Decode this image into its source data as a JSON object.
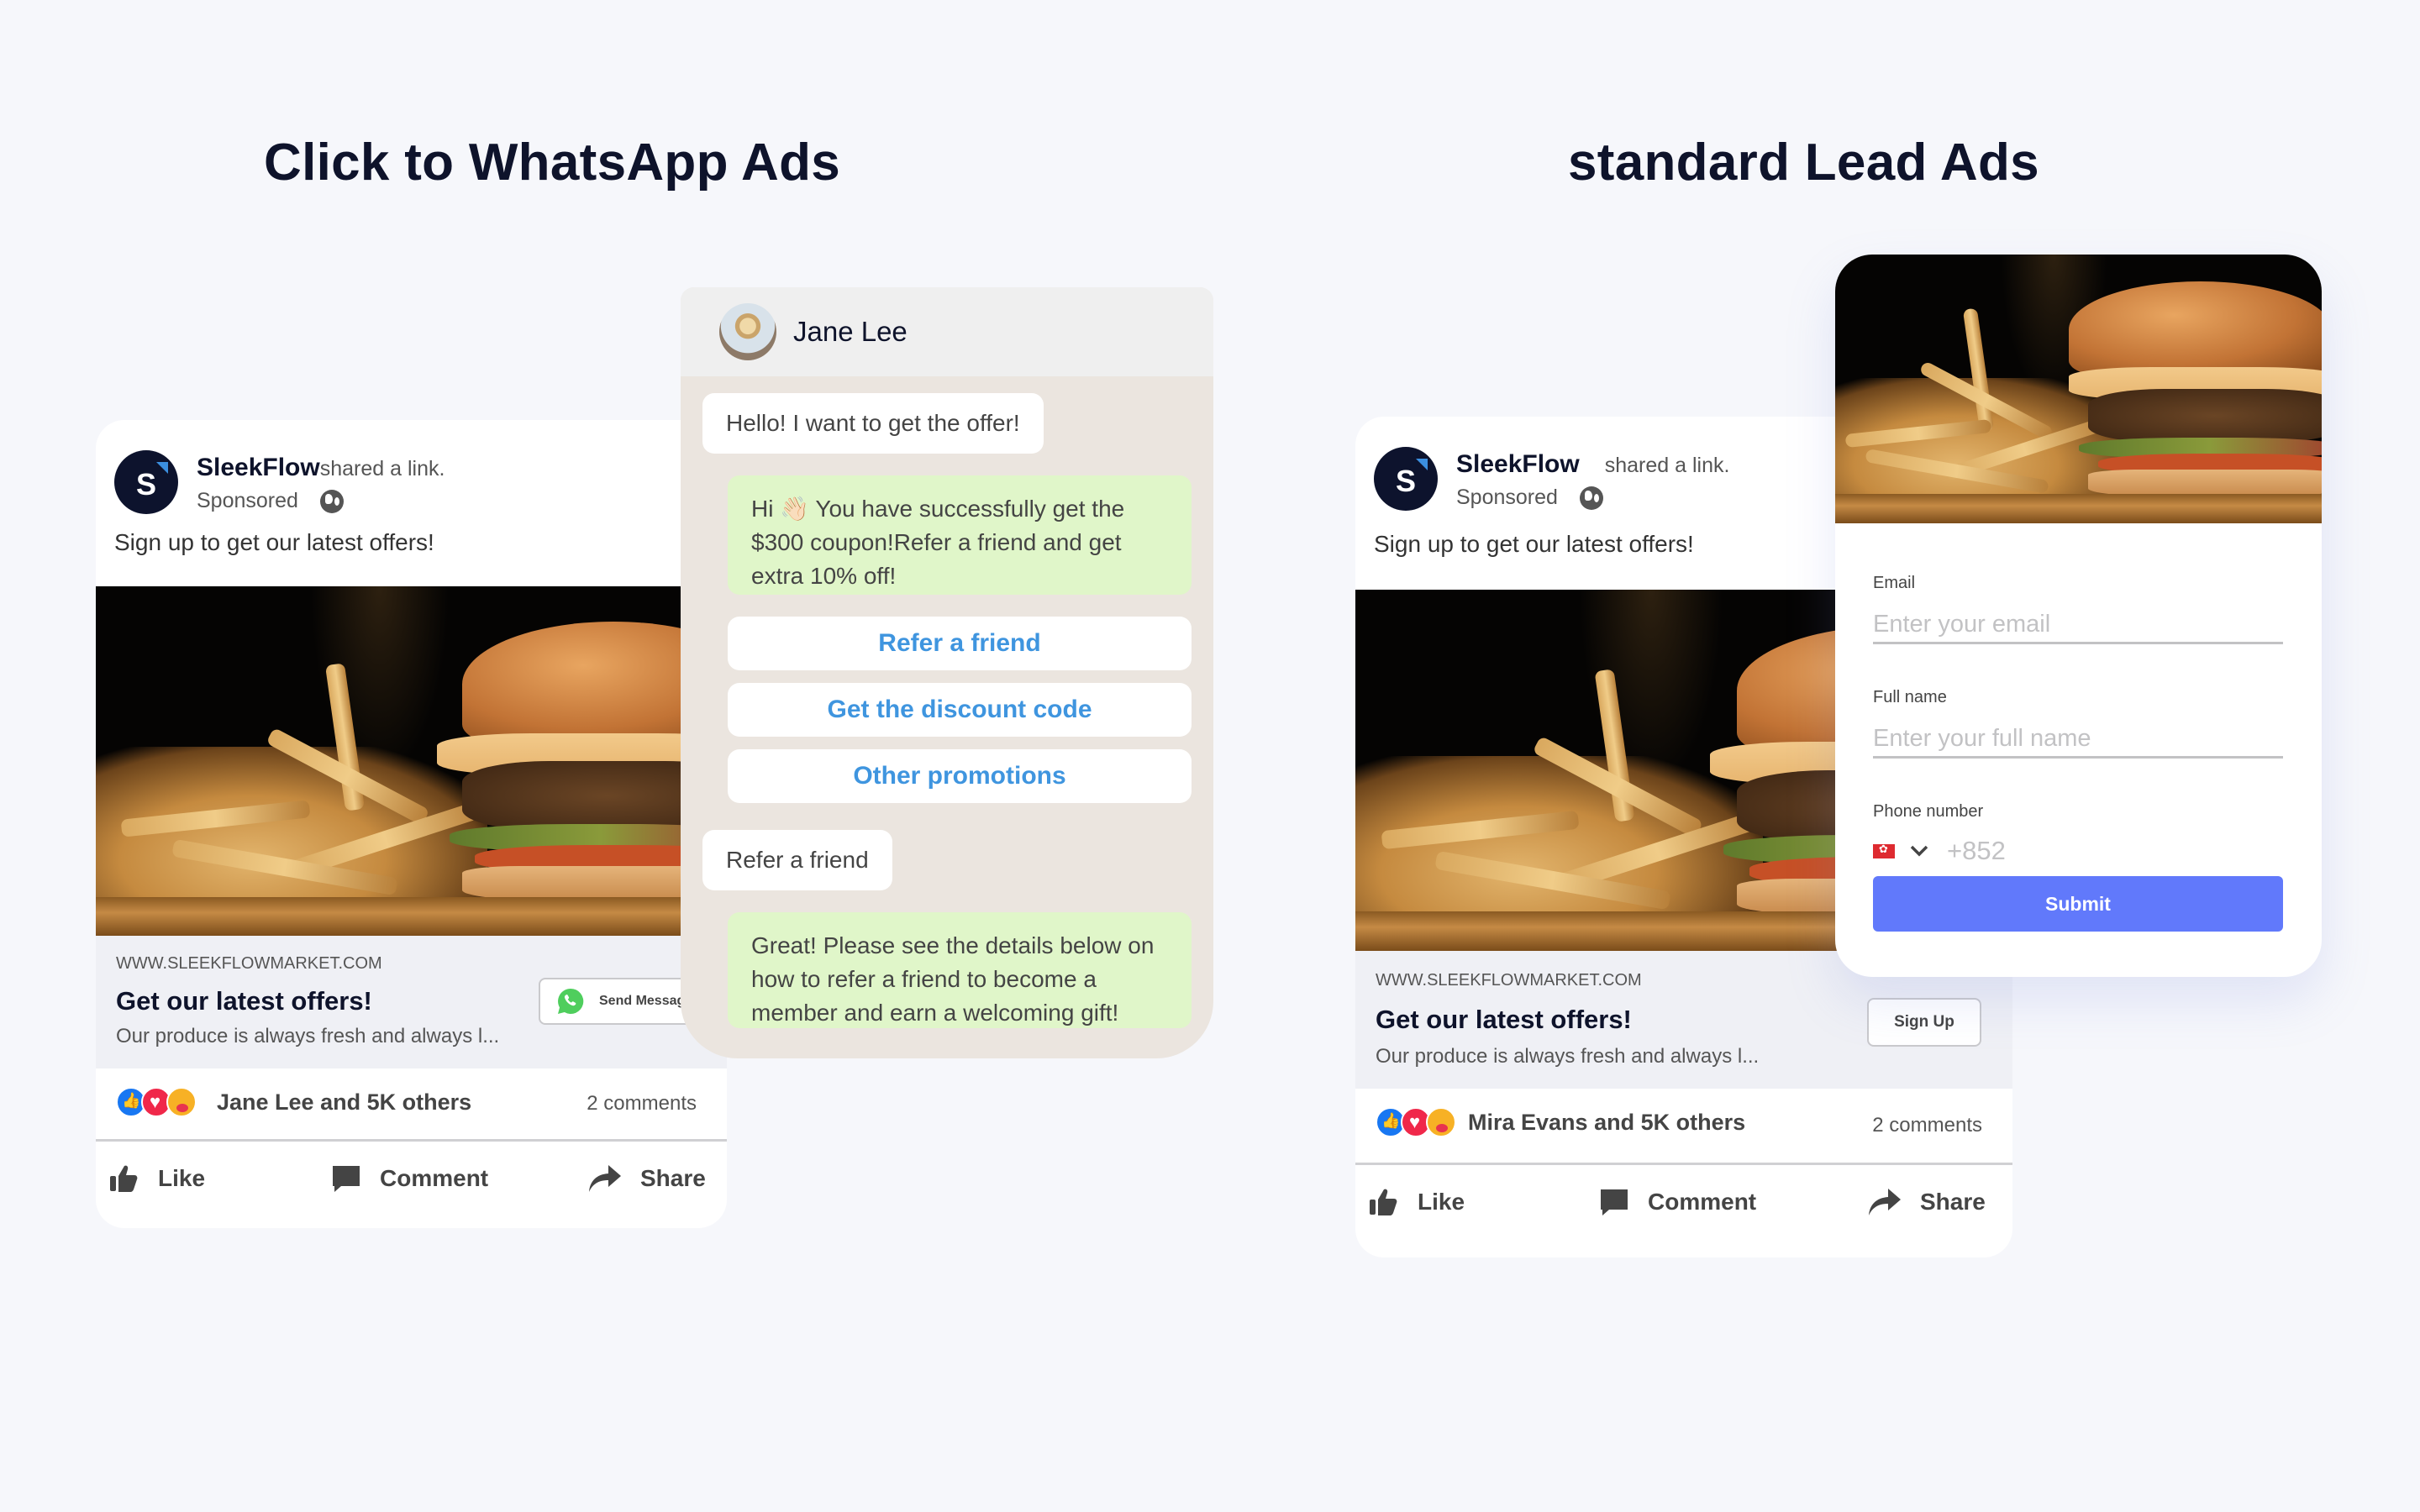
{
  "sections": {
    "left_title": "Click to WhatsApp Ads",
    "right_title": "standard Lead Ads"
  },
  "whatsapp_ad": {
    "brand": "SleekFlow",
    "avatar_letter": "S",
    "shared": "shared a link.",
    "sponsored": "Sponsored",
    "post_text": "Sign up to get our latest offers!",
    "domain": "WWW.SLEEKFLOWMARKET.COM",
    "headline": "Get our latest offers!",
    "description": "Our produce is always fresh and always l...",
    "cta_label": "Send Message",
    "reactions_text": "Jane Lee and 5K others",
    "comments": "2 comments",
    "actions": {
      "like": "Like",
      "comment": "Comment",
      "share": "Share"
    }
  },
  "chat": {
    "contact_name": "Jane Lee",
    "messages": [
      {
        "from": "user",
        "text": "Hello! I want to get the offer!"
      },
      {
        "from": "business",
        "text": "Hi 👋🏻 You have successfully get the $300 coupon!Refer a friend and get extra 10% off!"
      },
      {
        "from": "user",
        "text": "Refer a friend"
      },
      {
        "from": "business",
        "text": "Great! Please see the details below on how to refer a friend to become a member and earn a welcoming gift!"
      }
    ],
    "quick_replies": [
      "Refer a friend",
      "Get the discount code",
      "Other promotions"
    ]
  },
  "lead_ad": {
    "brand": "SleekFlow",
    "avatar_letter": "S",
    "shared": "shared a link.",
    "sponsored": "Sponsored",
    "post_text": "Sign up to get our latest offers!",
    "domain": "WWW.SLEEKFLOWMARKET.COM",
    "headline": "Get our latest offers!",
    "description": "Our produce is always fresh and always l...",
    "cta_label": "Sign Up",
    "reactions_text": "Mira Evans and 5K others",
    "comments": "2 comments",
    "actions": {
      "like": "Like",
      "comment": "Comment",
      "share": "Share"
    }
  },
  "lead_form": {
    "email_label": "Email",
    "email_placeholder": "Enter your email",
    "name_label": "Full name",
    "name_placeholder": "Enter your full name",
    "phone_label": "Phone number",
    "phone_country": "HK",
    "phone_placeholder": "+852",
    "submit_label": "Submit"
  },
  "colors": {
    "background": "#f6f7fb",
    "title": "#0e132b",
    "brand_avatar": "#0d132d",
    "quick_reply_text": "#3f95df",
    "outgoing_bubble": "#e0f6c9",
    "chat_background": "#ebe5df",
    "submit_button": "#6179fb",
    "whatsapp_green": "#4fce5d"
  }
}
